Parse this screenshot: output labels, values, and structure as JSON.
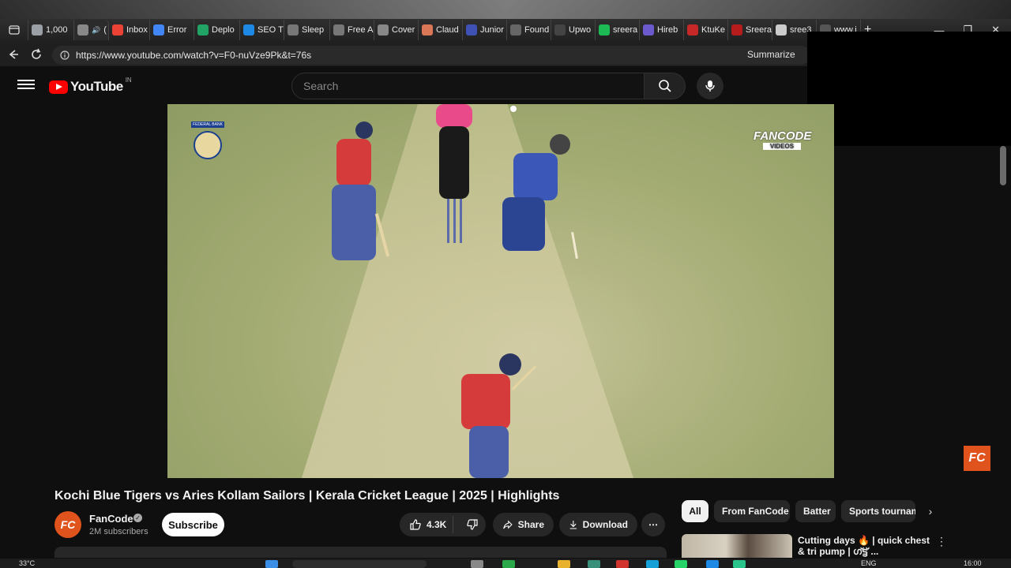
{
  "browser": {
    "tabs": [
      {
        "label": "1,000",
        "color": "#9aa0a6"
      },
      {
        "label": "(",
        "color": "#888888",
        "active": true
      },
      {
        "label": "Inbox",
        "color": "#ea4335"
      },
      {
        "label": "Error",
        "color": "#4285f4"
      },
      {
        "label": "Deplo",
        "color": "#21a366"
      },
      {
        "label": "SEO T",
        "color": "#1e88e5"
      },
      {
        "label": "Sleep",
        "color": "#777777"
      },
      {
        "label": "Free A",
        "color": "#777777"
      },
      {
        "label": "Cover",
        "color": "#888888"
      },
      {
        "label": "Claud",
        "color": "#d97757"
      },
      {
        "label": "Junior",
        "color": "#3f51b5"
      },
      {
        "label": "Found",
        "color": "#666666"
      },
      {
        "label": "Upwo",
        "color": "#444444"
      },
      {
        "label": "sreera",
        "color": "#1db954"
      },
      {
        "label": "Hireb",
        "color": "#6a5acd"
      },
      {
        "label": "KtuKe",
        "color": "#c62828"
      },
      {
        "label": "Sreera",
        "color": "#b71c1c"
      },
      {
        "label": "sree3",
        "color": "#cccccc"
      },
      {
        "label": "www.i",
        "color": "#555555"
      }
    ],
    "new_tab": "+",
    "window_controls": {
      "minimize": "—",
      "maximize": "❐",
      "close": "✕"
    },
    "url": "https://www.youtube.com/watch?v=F0-nuVze9Pk&t=76s",
    "summarize_label": "Summarize"
  },
  "youtube": {
    "logo_text": "YouTube",
    "country_code": "IN",
    "search_placeholder": "Search",
    "video": {
      "watermark": "FANCODE",
      "watermark_sub": "VIDEOS",
      "league_badge": "FEDERAL BANK",
      "corner_logo": "FC"
    },
    "title": "Kochi Blue Tigers vs Aries Kollam Sailors | Kerala Cricket League | 2025 | Highlights",
    "channel": {
      "avatar_text": "FC",
      "name": "FanCode",
      "verified_mark": "✓",
      "subscribers": "2M subscribers"
    },
    "subscribe_label": "Subscribe",
    "actions": {
      "likes": "4.3K",
      "share": "Share",
      "download": "Download",
      "more": "⋯"
    },
    "chips": [
      "All",
      "From FanCode",
      "Batter",
      "Sports tournam"
    ],
    "recommendation": {
      "title": "Cutting days 🔥 | quick chest & tri pump | ഗ്ട്ട്‍ ...",
      "more": "⋮"
    }
  },
  "taskbar": {
    "weather": "33°C",
    "language": "ENG",
    "clock": "16:00"
  },
  "colors": {
    "youtube_red": "#ff0000",
    "fancode_orange": "#e0531c",
    "background": "#0f0f0f"
  }
}
